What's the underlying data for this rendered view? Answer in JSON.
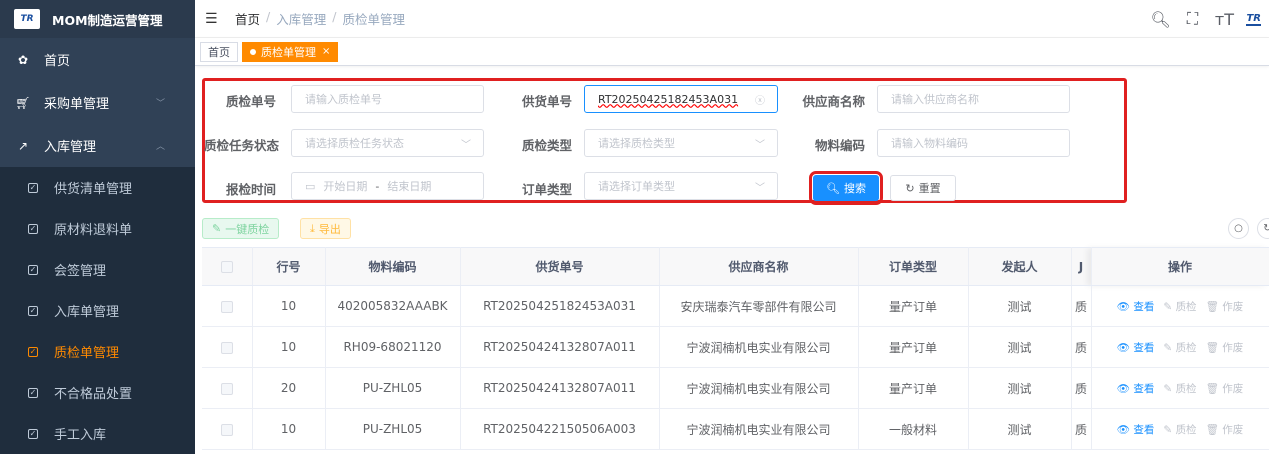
{
  "app": {
    "title": "MOM制造运营管理",
    "logo_text": "TR"
  },
  "sidebar": {
    "home": "首页",
    "purchase": "采购单管理",
    "inbound": "入库管理",
    "sub_items": [
      "供货清单管理",
      "原材料退料单",
      "会签管理",
      "入库单管理",
      "质检单管理",
      "不合格品处置",
      "手工入库"
    ]
  },
  "navbar": {
    "breadcrumb": [
      "首页",
      "入库管理",
      "质检单管理"
    ],
    "sep": "/",
    "logo_text": "TR"
  },
  "tags": {
    "home": "首页",
    "current": "质检单管理"
  },
  "form": {
    "qc_no_label": "质检单号",
    "qc_no_placeholder": "请输入质检单号",
    "supply_no_label": "供货单号",
    "supply_no_value": "RT20250425182453A031",
    "supplier_label": "供应商名称",
    "supplier_placeholder": "请输入供应商名称",
    "task_status_label": "质检任务状态",
    "task_status_placeholder": "请选择质检任务状态",
    "qc_type_label": "质检类型",
    "qc_type_placeholder": "请选择质检类型",
    "material_label": "物料编码",
    "material_placeholder": "请输入物料编码",
    "time_label": "报检时间",
    "start_placeholder": "开始日期",
    "range_sep": "-",
    "end_placeholder": "结束日期",
    "order_type_label": "订单类型",
    "order_type_placeholder": "请选择订单类型",
    "search_btn": "搜索",
    "reset_btn": "重置"
  },
  "toolbar": {
    "one_click_qc": "一键质检",
    "export": "导出"
  },
  "table": {
    "headers": [
      "行号",
      "物料编码",
      "供货单号",
      "供应商名称",
      "订单类型",
      "发起人",
      "",
      "操作"
    ],
    "col7_hint": "J",
    "rows": [
      {
        "line": "10",
        "material": "402005832AAABK",
        "supply_no": "RT20250425182453A031",
        "supplier": "安庆瑞泰汽车零部件有限公司",
        "order_type": "量产订单",
        "initiator": "测试",
        "extra": "质"
      },
      {
        "line": "10",
        "material": "RH09-68021120",
        "supply_no": "RT20250424132807A011",
        "supplier": "宁波润楠机电实业有限公司",
        "order_type": "量产订单",
        "initiator": "测试",
        "extra": "质"
      },
      {
        "line": "20",
        "material": "PU-ZHL05",
        "supply_no": "RT20250424132807A011",
        "supplier": "宁波润楠机电实业有限公司",
        "order_type": "量产订单",
        "initiator": "测试",
        "extra": "质"
      },
      {
        "line": "10",
        "material": "PU-ZHL05",
        "supply_no": "RT20250422150506A003",
        "supplier": "宁波润楠机电实业有限公司",
        "order_type": "一般材料",
        "initiator": "测试",
        "extra": "质"
      }
    ],
    "ops": {
      "view": "查看",
      "qc": "质检",
      "void": "作废"
    }
  },
  "colors": {
    "sidebar_bg": "#304156",
    "accent": "#ff8a00",
    "primary": "#1890ff",
    "highlight": "#e02020"
  }
}
